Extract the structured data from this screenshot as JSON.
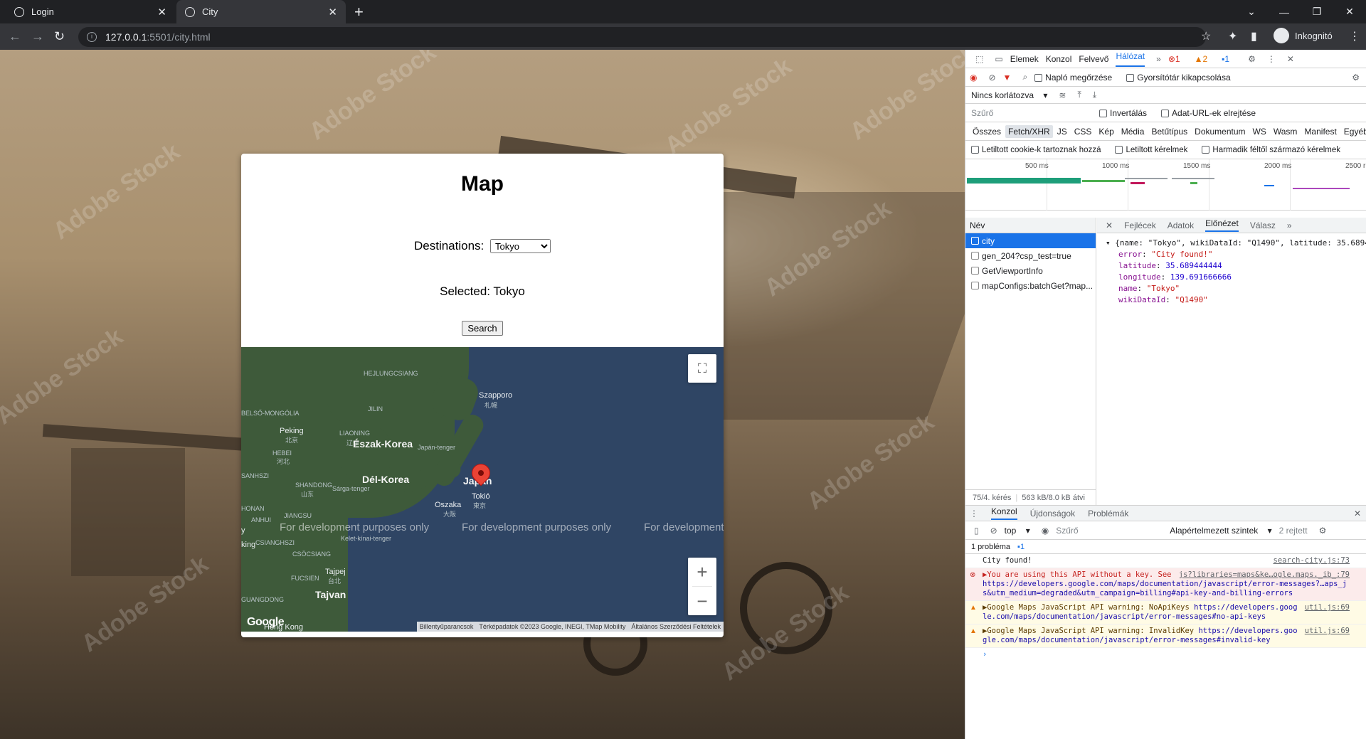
{
  "browser": {
    "tabs": [
      {
        "title": "Login",
        "active": false
      },
      {
        "title": "City",
        "active": true
      }
    ],
    "url_host": "127.0.0.1",
    "url_path": ":5501/city.html",
    "profile_label": "Inkognitó"
  },
  "page": {
    "title": "Map",
    "destinations_label": "Destinations:",
    "destination_options": [
      "Tokyo"
    ],
    "destination_selected": "Tokyo",
    "selected_text": "Selected: Tokyo",
    "search_label": "Search",
    "map": {
      "labels": {
        "sapporo": "Szapporo",
        "sapporo_kanji": "札幌",
        "north_korea": "Észak-Korea",
        "south_korea": "Dél-Korea",
        "japan": "Japán",
        "tokyo": "Tokió",
        "tokyo_kanji": "東京",
        "osaka": "Oszaka",
        "osaka_kanji": "大阪",
        "peking": "Peking",
        "peking_kanji": "北京",
        "hebei": "HEBEI",
        "hebei_kanji": "河北",
        "liaoning": "LIAONING",
        "liaoning_kanji": "辽宁",
        "jilin": "JILIN",
        "mongolia": "BELSŐ-MONGÓLIA",
        "heilongjiang": "HEJLUNGCSIANG",
        "shandong": "SHANDONG",
        "shandong_kanji": "山东",
        "shanxi": "SANHSZI",
        "anhui": "ANHUI",
        "jiangsu": "JIANGSU",
        "henan": "HONAN",
        "jiangxi": "CSIANGHSZI",
        "zhejiang": "CSÖCSIANG",
        "fujian": "FUCSIEN",
        "taipei": "Tajpej",
        "taipei_kanji": "台北",
        "taiwan": "Tajvan",
        "hong_kong": "Hong Kong",
        "guangdong": "GUANGDONG",
        "sea_japan": "Japán-tenger",
        "sea_yellow": "Sárga-tenger",
        "sea_east_china": "Kelet-kínai-tenger",
        "edge_king": "king",
        "edge_y": "y"
      },
      "dev_watermark": "For development purposes only",
      "attribution": {
        "shortcuts": "Billentyűparancsok",
        "data": "Térképadatok ©2023 Google, INEGI, TMap Mobility",
        "terms": "Általános Szerződési Feltételek"
      },
      "logo": "Google"
    }
  },
  "devtools": {
    "main_tabs": [
      "Elemek",
      "Konzol",
      "Felvevő",
      "Hálózat"
    ],
    "active_main_tab": "Hálózat",
    "badges": {
      "errors": "1",
      "warnings": "2",
      "info": "1"
    },
    "network_options": {
      "preserve_log": "Napló megőrzése",
      "disable_cache": "Gyorsítótár kikapcsolása",
      "throttle": "Nincs korlátozva"
    },
    "filter_placeholder": "Szűrő",
    "invert": "Invertálás",
    "hide_data_urls": "Adat-URL-ek elrejtése",
    "type_filters": [
      "Összes",
      "Fetch/XHR",
      "JS",
      "CSS",
      "Kép",
      "Média",
      "Betűtípus",
      "Dokumentum",
      "WS",
      "Wasm",
      "Manifest",
      "Egyéb"
    ],
    "active_type_filter": "Fetch/XHR",
    "blocked_cookies": "Letiltott cookie-k tartoznak hozzá",
    "blocked_requests": "Letiltott kérelmek",
    "third_party": "Harmadik féltől származó kérelmek",
    "timeline_ticks": [
      "500 ms",
      "1000 ms",
      "1500 ms",
      "2000 ms",
      "2500 r"
    ],
    "name_header": "Név",
    "requests": [
      "city",
      "gen_204?csp_test=true",
      "GetViewportInfo",
      "mapConfigs:batchGet?map..."
    ],
    "selected_request": "city",
    "request_footer_count": "75/4. kérés",
    "request_footer_size": "563 kB/8.0 kB átvi",
    "preview_tabs": [
      "Fejlécek",
      "Adatok",
      "Előnézet",
      "Válasz"
    ],
    "active_preview_tab": "Előnézet",
    "preview": {
      "summary": "{name: \"Tokyo\", wikiDataId: \"Q1490\", latitude: 35.6894",
      "fields": [
        {
          "key": "error",
          "value": "\"City found!\"",
          "kind": "string"
        },
        {
          "key": "latitude",
          "value": "35.689444444",
          "kind": "number"
        },
        {
          "key": "longitude",
          "value": "139.691666666",
          "kind": "number"
        },
        {
          "key": "name",
          "value": "\"Tokyo\"",
          "kind": "string"
        },
        {
          "key": "wikiDataId",
          "value": "\"Q1490\"",
          "kind": "string"
        }
      ]
    },
    "console": {
      "tabs": [
        "Konzol",
        "Újdonságok",
        "Problémák"
      ],
      "active_tab": "Konzol",
      "context": "top",
      "filter_placeholder": "Szűrő",
      "levels": "Alapértelmezett szintek",
      "hidden": "2 rejtett",
      "issues": "1 probléma",
      "issues_count": "1",
      "messages": [
        {
          "kind": "log",
          "text": "City found!",
          "source": "search-city.js:73"
        },
        {
          "kind": "error",
          "text": "▶You are using this API without a key. See ",
          "link": "https://developers.google.com/maps/documentation/javascript/error-messages?…aps_js&utm_medium=degraded&utm_campaign=billing#api-key-and-billing-errors",
          "source": "js?libraries=maps&ke…ogle.maps._ib_:79"
        },
        {
          "kind": "warn",
          "text": "▶Google Maps JavaScript API warning: NoApiKeys ",
          "link": "https://developers.google.com/maps/documentation/javascript/error-messages#no-api-keys",
          "source": "util.js:69"
        },
        {
          "kind": "warn",
          "text": "▶Google Maps JavaScript API warning: InvalidKey ",
          "link": "https://developers.google.com/maps/documentation/javascript/error-messages#invalid-key",
          "source": "util.js:69"
        }
      ]
    }
  }
}
